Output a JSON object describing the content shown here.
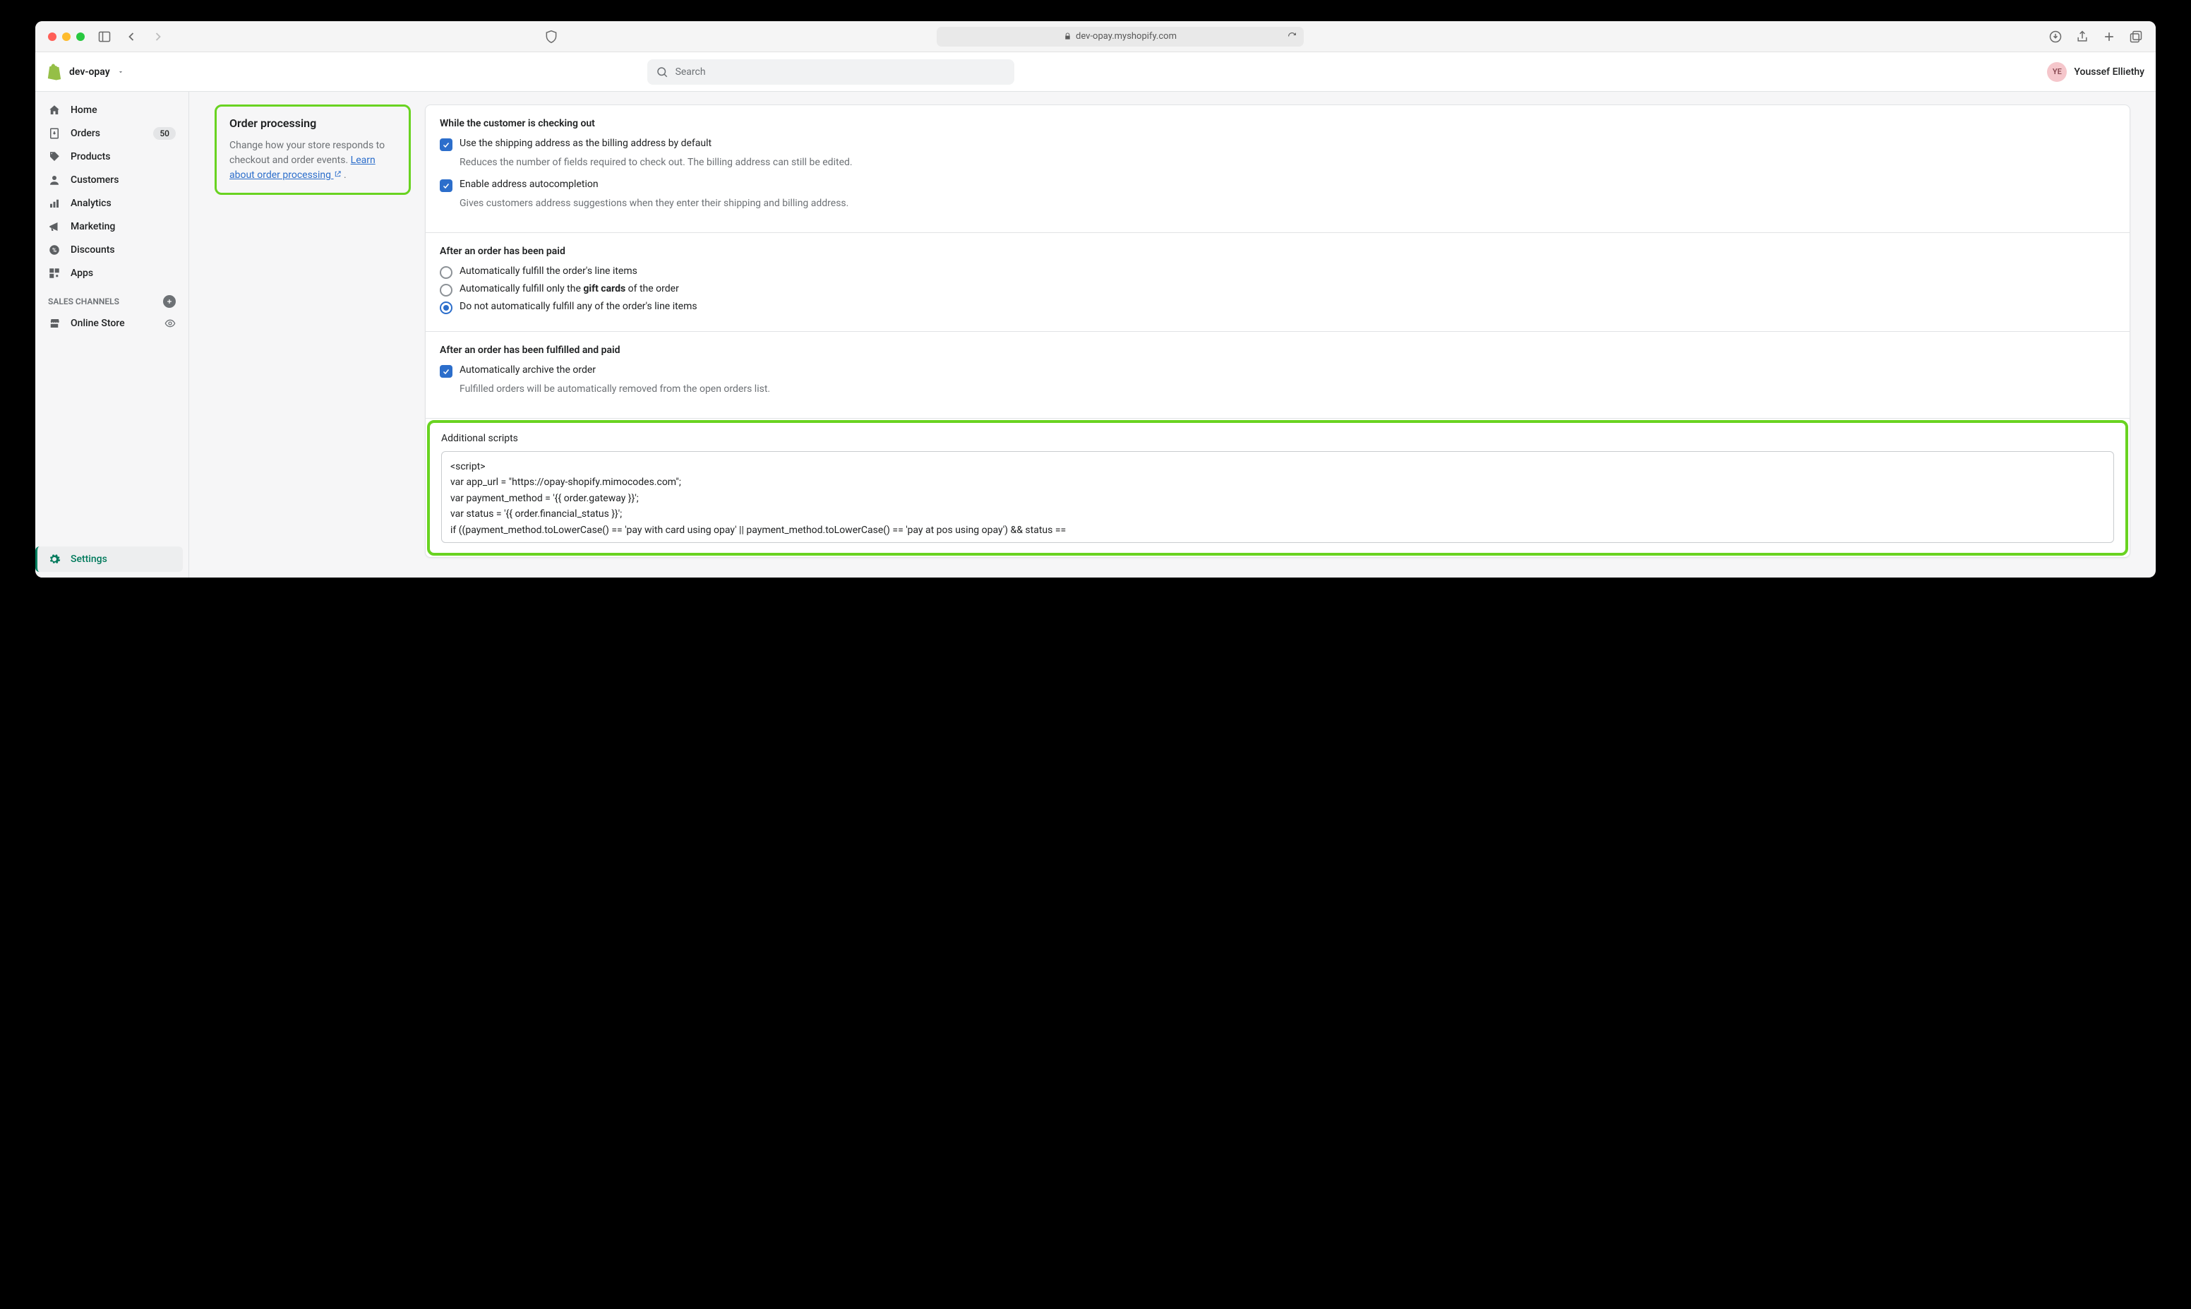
{
  "browser": {
    "url": "dev-opay.myshopify.com"
  },
  "header": {
    "store_name": "dev-opay",
    "search_placeholder": "Search",
    "user_initials": "YE",
    "user_name": "Youssef Elliethy"
  },
  "sidebar": {
    "items": [
      {
        "label": "Home",
        "icon": "home"
      },
      {
        "label": "Orders",
        "icon": "orders",
        "badge": "50"
      },
      {
        "label": "Products",
        "icon": "products"
      },
      {
        "label": "Customers",
        "icon": "customers"
      },
      {
        "label": "Analytics",
        "icon": "analytics"
      },
      {
        "label": "Marketing",
        "icon": "marketing"
      },
      {
        "label": "Discounts",
        "icon": "discounts"
      },
      {
        "label": "Apps",
        "icon": "apps"
      }
    ],
    "section_label": "SALES CHANNELS",
    "channels": [
      {
        "label": "Online Store",
        "icon": "store"
      }
    ],
    "settings_label": "Settings"
  },
  "side_panel": {
    "title": "Order processing",
    "desc_pre": "Change how your store responds to checkout and order events. ",
    "link": "Learn about order processing",
    "desc_post": " ."
  },
  "sections": {
    "checkout": {
      "title": "While the customer is checking out",
      "opts": [
        {
          "label": "Use the shipping address as the billing address by default",
          "help": "Reduces the number of fields required to check out. The billing address can still be edited.",
          "checked": true
        },
        {
          "label": "Enable address autocompletion",
          "help": "Gives customers address suggestions when they enter their shipping and billing address.",
          "checked": true
        }
      ]
    },
    "paid": {
      "title": "After an order has been paid",
      "opts": [
        {
          "label": "Automatically fulfill the order's line items",
          "selected": false
        },
        {
          "label_pre": "Automatically fulfill only the ",
          "label_bold": "gift cards",
          "label_post": " of the order",
          "selected": false
        },
        {
          "label": "Do not automatically fulfill any of the order's line items",
          "selected": true
        }
      ]
    },
    "fulfilled": {
      "title": "After an order has been fulfilled and paid",
      "opts": [
        {
          "label": "Automatically archive the order",
          "help": "Fulfilled orders will be automatically removed from the open orders list.",
          "checked": true
        }
      ]
    },
    "scripts": {
      "title": "Additional scripts",
      "value": "<script>\nvar app_url = \"https://opay-shopify.mimocodes.com\";\nvar payment_method = '{{ order.gateway }}';\nvar status = '{{ order.financial_status }}';\nif ((payment_method.toLowerCase() == 'pay with card using opay' || payment_method.toLowerCase() == 'pay at pos using opay') && status =="
    }
  }
}
